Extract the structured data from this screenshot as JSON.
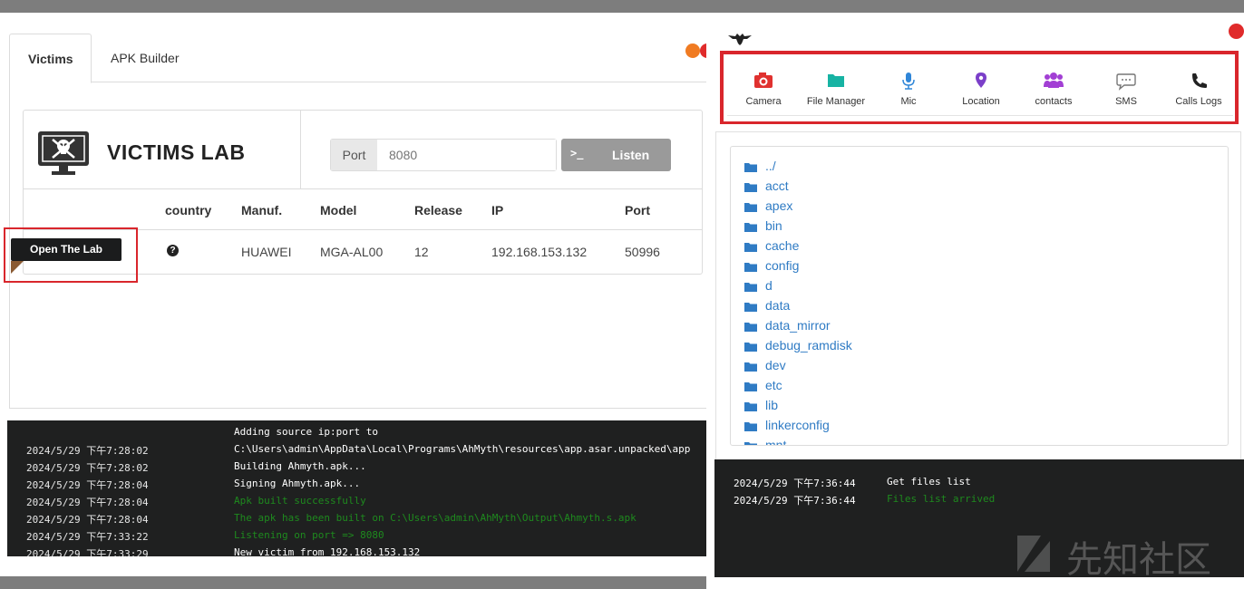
{
  "left": {
    "tabs": [
      {
        "label": "Victims",
        "active": true
      },
      {
        "label": "APK Builder",
        "active": false
      }
    ],
    "lab_title": "VICTIMS LAB",
    "port_label": "Port",
    "port_placeholder": "8080",
    "listen_label": "Listen",
    "table": {
      "columns": [
        "country",
        "Manuf.",
        "Model",
        "Release",
        "IP",
        "Port"
      ],
      "row": {
        "action": "Open The Lab",
        "country": "?",
        "manuf": "HUAWEI",
        "model": "MGA-AL00",
        "release": "12",
        "ip": "192.168.153.132",
        "port": "50996"
      }
    },
    "console": [
      {
        "time": "",
        "msg": "Adding source ip:port to",
        "status": "info"
      },
      {
        "time": "2024/5/29 下午7:28:02",
        "msg": "C:\\Users\\admin\\AppData\\Local\\Programs\\AhMyth\\resources\\app.asar.unpacked\\app",
        "status": "info"
      },
      {
        "time": "2024/5/29 下午7:28:02",
        "msg": "Building Ahmyth.apk...",
        "status": "info"
      },
      {
        "time": "2024/5/29 下午7:28:04",
        "msg": "Signing Ahmyth.apk...",
        "status": "info"
      },
      {
        "time": "2024/5/29 下午7:28:04",
        "msg": "Apk built successfully",
        "status": "success"
      },
      {
        "time": "2024/5/29 下午7:28:04",
        "msg": "The apk has been built on C:\\Users\\admin\\AhMyth\\Output\\Ahmyth.s.apk",
        "status": "success"
      },
      {
        "time": "2024/5/29 下午7:33:22",
        "msg": "Listening on port => 8080",
        "status": "success"
      },
      {
        "time": "2024/5/29 下午7:33:29",
        "msg": "New victim from 192.168.153.132",
        "status": "info"
      }
    ]
  },
  "right": {
    "toolbar": [
      {
        "label": "Camera",
        "icon": "camera-icon",
        "color": "#e0312f"
      },
      {
        "label": "File Manager",
        "icon": "folder-icon",
        "color": "#17b3a3"
      },
      {
        "label": "Mic",
        "icon": "microphone-icon",
        "color": "#2f86d8"
      },
      {
        "label": "Location",
        "icon": "location-pin-icon",
        "color": "#7b3fc9"
      },
      {
        "label": "contacts",
        "icon": "contacts-icon",
        "color": "#a23fd4"
      },
      {
        "label": "SMS",
        "icon": "sms-bubble-icon",
        "color": "#777777"
      },
      {
        "label": "Calls Logs",
        "icon": "phone-icon",
        "color": "#222222"
      }
    ],
    "files": [
      "../",
      "acct",
      "apex",
      "bin",
      "cache",
      "config",
      "d",
      "data",
      "data_mirror",
      "debug_ramdisk",
      "dev",
      "etc",
      "lib",
      "linkerconfig",
      "mnt"
    ],
    "console": [
      {
        "time": "2024/5/29 下午7:36:44",
        "msg": "Get files list",
        "status": "info"
      },
      {
        "time": "2024/5/29 下午7:36:44",
        "msg": "Files list arrived",
        "status": "success"
      }
    ],
    "watermark": "先知社区"
  },
  "colors": {
    "folder": "#2f7bc4",
    "highlight": "#d9262c",
    "console_bg": "#1f2020",
    "success": "#1e8a1e"
  }
}
